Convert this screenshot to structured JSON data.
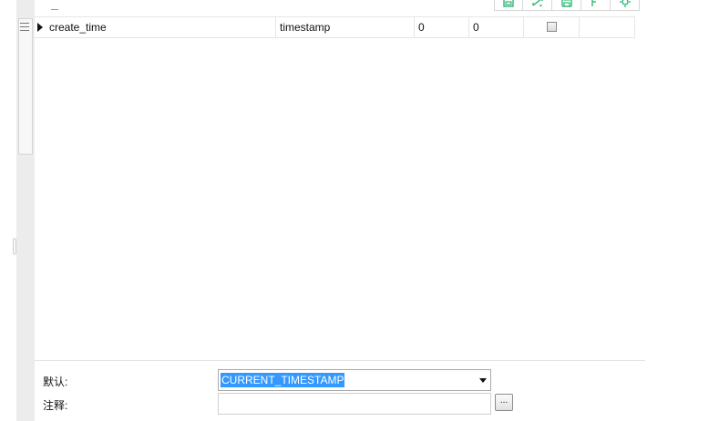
{
  "toolbar": {
    "buttons": [
      {
        "icon": "save-icon"
      },
      {
        "icon": "expand-icon"
      },
      {
        "icon": "save-disk-icon"
      },
      {
        "icon": "export-icon"
      },
      {
        "icon": "settings-icon"
      }
    ],
    "accent_color": "#1db36b"
  },
  "fields": [
    {
      "name": "create_time",
      "type": "timestamp",
      "length": "0",
      "decimals": "0",
      "not_null": false,
      "key": ""
    }
  ],
  "properties": {
    "default_label": "默认:",
    "default_value": "CURRENT_TIMESTAMP",
    "comment_label": "注释:",
    "comment_value": "",
    "ellipsis_label": "..."
  }
}
